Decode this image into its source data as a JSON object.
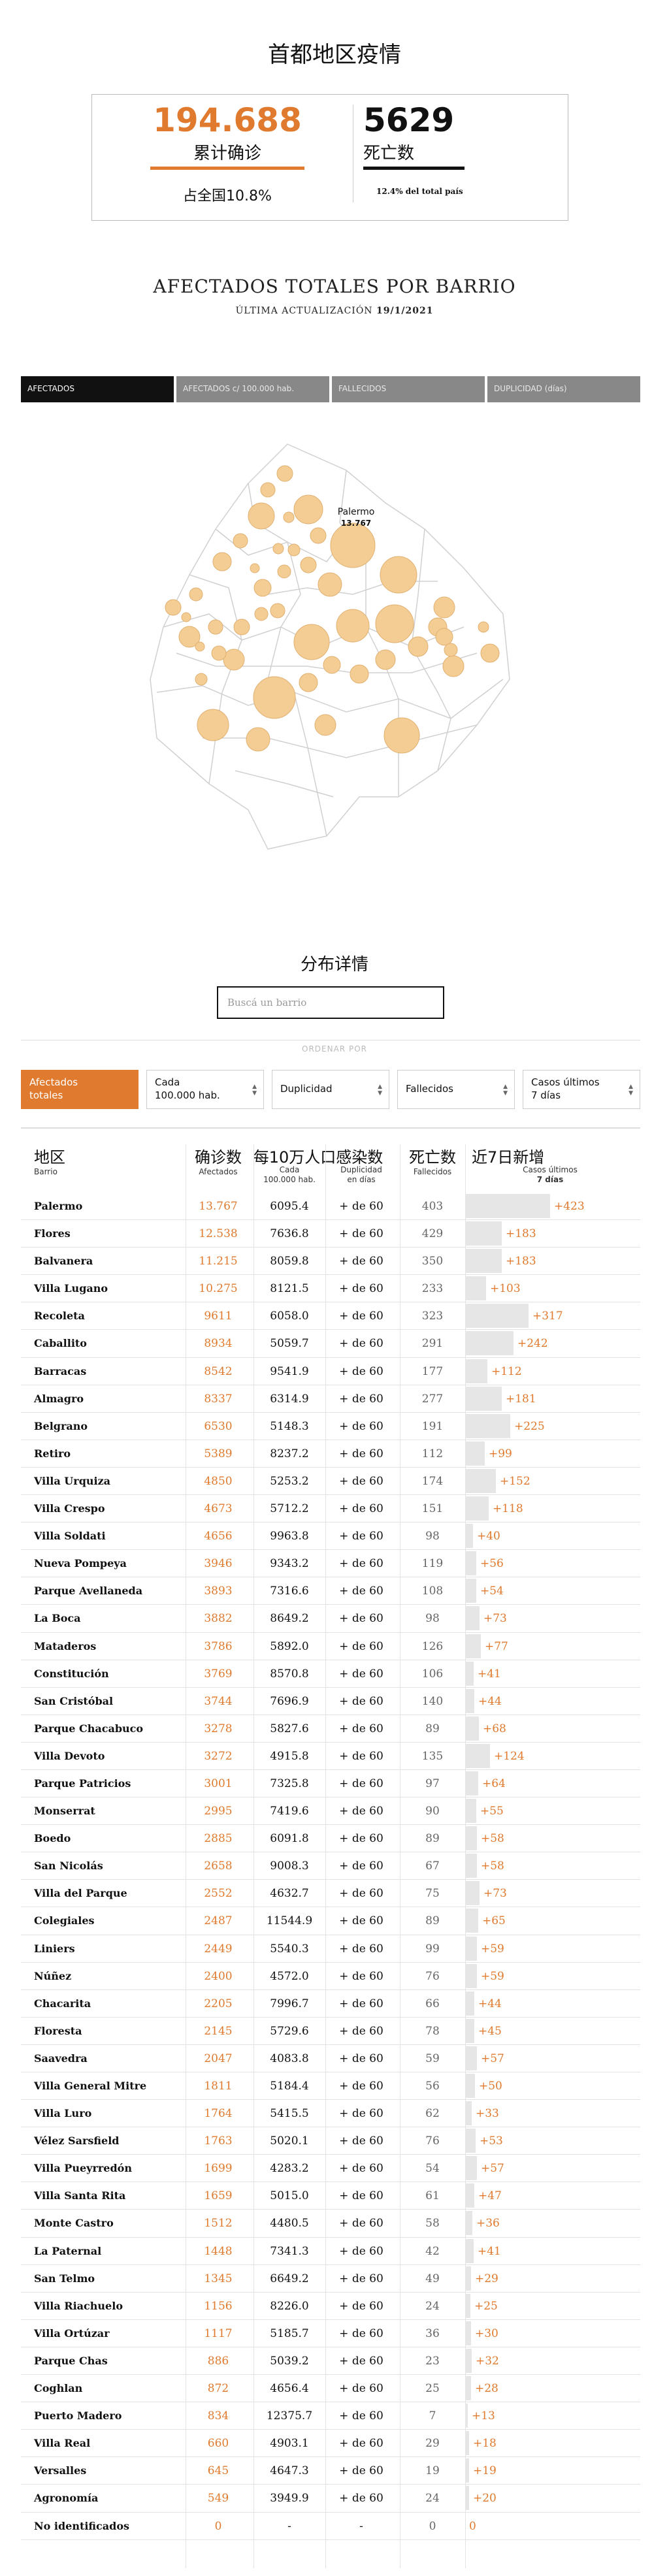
{
  "title": "首都地区疫情",
  "kpi": {
    "cases_value": "194.688",
    "cases_label": "累计确诊",
    "deaths_value": "5629",
    "deaths_label": "死亡数",
    "share_label": "占全国10.8%",
    "deaths_share": "12.4% del total país"
  },
  "section": {
    "heading": "AFECTADOS TOTALES POR BARRIO",
    "updated_prefix": "ÚLTIMA ACTUALIZACIÓN",
    "updated_date": "19/1/2021"
  },
  "tabs": [
    "AFECTADOS",
    "AFECTADOS c/ 100.000 hab.",
    "FALLECIDOS",
    "DUPLICIDAD (días)"
  ],
  "map": {
    "tooltip_name": "Palermo",
    "tooltip_value": "13.767"
  },
  "details": {
    "title": "分布详情",
    "search_placeholder": "Buscá un barrio",
    "order_by": "ORDENAR POR"
  },
  "sort_buttons": [
    {
      "line1": "Afectados",
      "line2": "totales"
    },
    {
      "line1": "Cada",
      "line2": "100.000 hab."
    },
    {
      "line1": "Duplicidad",
      "line2": ""
    },
    {
      "line1": "Fallecidos",
      "line2": ""
    },
    {
      "line1": "Casos últimos",
      "line2": "7 días"
    }
  ],
  "columns": {
    "barrio_cn": "地区",
    "barrio_es": "Barrio",
    "af_cn": "确诊数",
    "af_es": "Afectados",
    "cada_cn": "每10万人口感染数",
    "cada_es1": "Cada",
    "cada_es2": "100.000 hab.",
    "dup_cn": "",
    "dup_es1": "Duplicidad",
    "dup_es2": "en días",
    "fall_cn": "死亡数",
    "fall_es": "Fallecidos",
    "casos_cn": "近7日新增",
    "casos_es1": "Casos últimos",
    "casos_es2": "7 días"
  },
  "rows": [
    {
      "barrio": "Palermo",
      "afectados": "13.767",
      "cada": "6095.4",
      "dup": "+ de 60",
      "fallecidos": "403",
      "casos": "+423",
      "n": 423
    },
    {
      "barrio": "Flores",
      "afectados": "12.538",
      "cada": "7636.8",
      "dup": "+ de 60",
      "fallecidos": "429",
      "casos": "+183",
      "n": 183
    },
    {
      "barrio": "Balvanera",
      "afectados": "11.215",
      "cada": "8059.8",
      "dup": "+ de 60",
      "fallecidos": "350",
      "casos": "+183",
      "n": 183
    },
    {
      "barrio": "Villa Lugano",
      "afectados": "10.275",
      "cada": "8121.5",
      "dup": "+ de 60",
      "fallecidos": "233",
      "casos": "+103",
      "n": 103
    },
    {
      "barrio": "Recoleta",
      "afectados": "9611",
      "cada": "6058.0",
      "dup": "+ de 60",
      "fallecidos": "323",
      "casos": "+317",
      "n": 317
    },
    {
      "barrio": "Caballito",
      "afectados": "8934",
      "cada": "5059.7",
      "dup": "+ de 60",
      "fallecidos": "291",
      "casos": "+242",
      "n": 242
    },
    {
      "barrio": "Barracas",
      "afectados": "8542",
      "cada": "9541.9",
      "dup": "+ de 60",
      "fallecidos": "177",
      "casos": "+112",
      "n": 112
    },
    {
      "barrio": "Almagro",
      "afectados": "8337",
      "cada": "6314.9",
      "dup": "+ de 60",
      "fallecidos": "277",
      "casos": "+181",
      "n": 181
    },
    {
      "barrio": "Belgrano",
      "afectados": "6530",
      "cada": "5148.3",
      "dup": "+ de 60",
      "fallecidos": "191",
      "casos": "+225",
      "n": 225
    },
    {
      "barrio": "Retiro",
      "afectados": "5389",
      "cada": "8237.2",
      "dup": "+ de 60",
      "fallecidos": "112",
      "casos": "+99",
      "n": 99
    },
    {
      "barrio": "Villa Urquiza",
      "afectados": "4850",
      "cada": "5253.2",
      "dup": "+ de 60",
      "fallecidos": "174",
      "casos": "+152",
      "n": 152
    },
    {
      "barrio": "Villa Crespo",
      "afectados": "4673",
      "cada": "5712.2",
      "dup": "+ de 60",
      "fallecidos": "151",
      "casos": "+118",
      "n": 118
    },
    {
      "barrio": "Villa Soldati",
      "afectados": "4656",
      "cada": "9963.8",
      "dup": "+ de 60",
      "fallecidos": "98",
      "casos": "+40",
      "n": 40
    },
    {
      "barrio": "Nueva Pompeya",
      "afectados": "3946",
      "cada": "9343.2",
      "dup": "+ de 60",
      "fallecidos": "119",
      "casos": "+56",
      "n": 56
    },
    {
      "barrio": "Parque Avellaneda",
      "afectados": "3893",
      "cada": "7316.6",
      "dup": "+ de 60",
      "fallecidos": "108",
      "casos": "+54",
      "n": 54
    },
    {
      "barrio": "La Boca",
      "afectados": "3882",
      "cada": "8649.2",
      "dup": "+ de 60",
      "fallecidos": "98",
      "casos": "+73",
      "n": 73
    },
    {
      "barrio": "Mataderos",
      "afectados": "3786",
      "cada": "5892.0",
      "dup": "+ de 60",
      "fallecidos": "126",
      "casos": "+77",
      "n": 77
    },
    {
      "barrio": "Constitución",
      "afectados": "3769",
      "cada": "8570.8",
      "dup": "+ de 60",
      "fallecidos": "106",
      "casos": "+41",
      "n": 41
    },
    {
      "barrio": "San Cristóbal",
      "afectados": "3744",
      "cada": "7696.9",
      "dup": "+ de 60",
      "fallecidos": "140",
      "casos": "+44",
      "n": 44
    },
    {
      "barrio": "Parque Chacabuco",
      "afectados": "3278",
      "cada": "5827.6",
      "dup": "+ de 60",
      "fallecidos": "89",
      "casos": "+68",
      "n": 68
    },
    {
      "barrio": "Villa Devoto",
      "afectados": "3272",
      "cada": "4915.8",
      "dup": "+ de 60",
      "fallecidos": "135",
      "casos": "+124",
      "n": 124
    },
    {
      "barrio": "Parque Patricios",
      "afectados": "3001",
      "cada": "7325.8",
      "dup": "+ de 60",
      "fallecidos": "97",
      "casos": "+64",
      "n": 64
    },
    {
      "barrio": "Monserrat",
      "afectados": "2995",
      "cada": "7419.6",
      "dup": "+ de 60",
      "fallecidos": "90",
      "casos": "+55",
      "n": 55
    },
    {
      "barrio": "Boedo",
      "afectados": "2885",
      "cada": "6091.8",
      "dup": "+ de 60",
      "fallecidos": "89",
      "casos": "+58",
      "n": 58
    },
    {
      "barrio": "San Nicolás",
      "afectados": "2658",
      "cada": "9008.3",
      "dup": "+ de 60",
      "fallecidos": "67",
      "casos": "+58",
      "n": 58
    },
    {
      "barrio": "Villa del Parque",
      "afectados": "2552",
      "cada": "4632.7",
      "dup": "+ de 60",
      "fallecidos": "75",
      "casos": "+73",
      "n": 73
    },
    {
      "barrio": "Colegiales",
      "afectados": "2487",
      "cada": "11544.9",
      "dup": "+ de 60",
      "fallecidos": "89",
      "casos": "+65",
      "n": 65
    },
    {
      "barrio": "Liniers",
      "afectados": "2449",
      "cada": "5540.3",
      "dup": "+ de 60",
      "fallecidos": "99",
      "casos": "+59",
      "n": 59
    },
    {
      "barrio": "Núñez",
      "afectados": "2400",
      "cada": "4572.0",
      "dup": "+ de 60",
      "fallecidos": "76",
      "casos": "+59",
      "n": 59
    },
    {
      "barrio": "Chacarita",
      "afectados": "2205",
      "cada": "7996.7",
      "dup": "+ de 60",
      "fallecidos": "66",
      "casos": "+44",
      "n": 44
    },
    {
      "barrio": "Floresta",
      "afectados": "2145",
      "cada": "5729.6",
      "dup": "+ de 60",
      "fallecidos": "78",
      "casos": "+45",
      "n": 45
    },
    {
      "barrio": "Saavedra",
      "afectados": "2047",
      "cada": "4083.8",
      "dup": "+ de 60",
      "fallecidos": "59",
      "casos": "+57",
      "n": 57
    },
    {
      "barrio": "Villa General Mitre",
      "afectados": "1811",
      "cada": "5184.4",
      "dup": "+ de 60",
      "fallecidos": "56",
      "casos": "+50",
      "n": 50
    },
    {
      "barrio": "Villa Luro",
      "afectados": "1764",
      "cada": "5415.5",
      "dup": "+ de 60",
      "fallecidos": "62",
      "casos": "+33",
      "n": 33
    },
    {
      "barrio": "Vélez Sarsfield",
      "afectados": "1763",
      "cada": "5020.1",
      "dup": "+ de 60",
      "fallecidos": "76",
      "casos": "+53",
      "n": 53
    },
    {
      "barrio": "Villa Pueyrredón",
      "afectados": "1699",
      "cada": "4283.2",
      "dup": "+ de 60",
      "fallecidos": "54",
      "casos": "+57",
      "n": 57
    },
    {
      "barrio": "Villa Santa Rita",
      "afectados": "1659",
      "cada": "5015.0",
      "dup": "+ de 60",
      "fallecidos": "61",
      "casos": "+47",
      "n": 47
    },
    {
      "barrio": "Monte Castro",
      "afectados": "1512",
      "cada": "4480.5",
      "dup": "+ de 60",
      "fallecidos": "58",
      "casos": "+36",
      "n": 36
    },
    {
      "barrio": "La Paternal",
      "afectados": "1448",
      "cada": "7341.3",
      "dup": "+ de 60",
      "fallecidos": "42",
      "casos": "+41",
      "n": 41
    },
    {
      "barrio": "San Telmo",
      "afectados": "1345",
      "cada": "6649.2",
      "dup": "+ de 60",
      "fallecidos": "49",
      "casos": "+29",
      "n": 29
    },
    {
      "barrio": "Villa Riachuelo",
      "afectados": "1156",
      "cada": "8226.0",
      "dup": "+ de 60",
      "fallecidos": "24",
      "casos": "+25",
      "n": 25
    },
    {
      "barrio": "Villa Ortúzar",
      "afectados": "1117",
      "cada": "5185.7",
      "dup": "+ de 60",
      "fallecidos": "36",
      "casos": "+30",
      "n": 30
    },
    {
      "barrio": "Parque Chas",
      "afectados": "886",
      "cada": "5039.2",
      "dup": "+ de 60",
      "fallecidos": "23",
      "casos": "+32",
      "n": 32
    },
    {
      "barrio": "Coghlan",
      "afectados": "872",
      "cada": "4656.4",
      "dup": "+ de 60",
      "fallecidos": "25",
      "casos": "+28",
      "n": 28
    },
    {
      "barrio": "Puerto Madero",
      "afectados": "834",
      "cada": "12375.7",
      "dup": "+ de 60",
      "fallecidos": "7",
      "casos": "+13",
      "n": 13
    },
    {
      "barrio": "Villa Real",
      "afectados": "660",
      "cada": "4903.1",
      "dup": "+ de 60",
      "fallecidos": "29",
      "casos": "+18",
      "n": 18
    },
    {
      "barrio": "Versalles",
      "afectados": "645",
      "cada": "4647.3",
      "dup": "+ de 60",
      "fallecidos": "19",
      "casos": "+19",
      "n": 19
    },
    {
      "barrio": "Agronomía",
      "afectados": "549",
      "cada": "3949.9",
      "dup": "+ de 60",
      "fallecidos": "24",
      "casos": "+20",
      "n": 20
    },
    {
      "barrio": "No identificados",
      "afectados": "0",
      "cada": "-",
      "dup": "-",
      "fallecidos": "0",
      "casos": "0",
      "n": 0
    }
  ],
  "colors": {
    "accent": "#e07a2e",
    "bubble": "#f4cd95",
    "bar": "#e6e6e6"
  }
}
